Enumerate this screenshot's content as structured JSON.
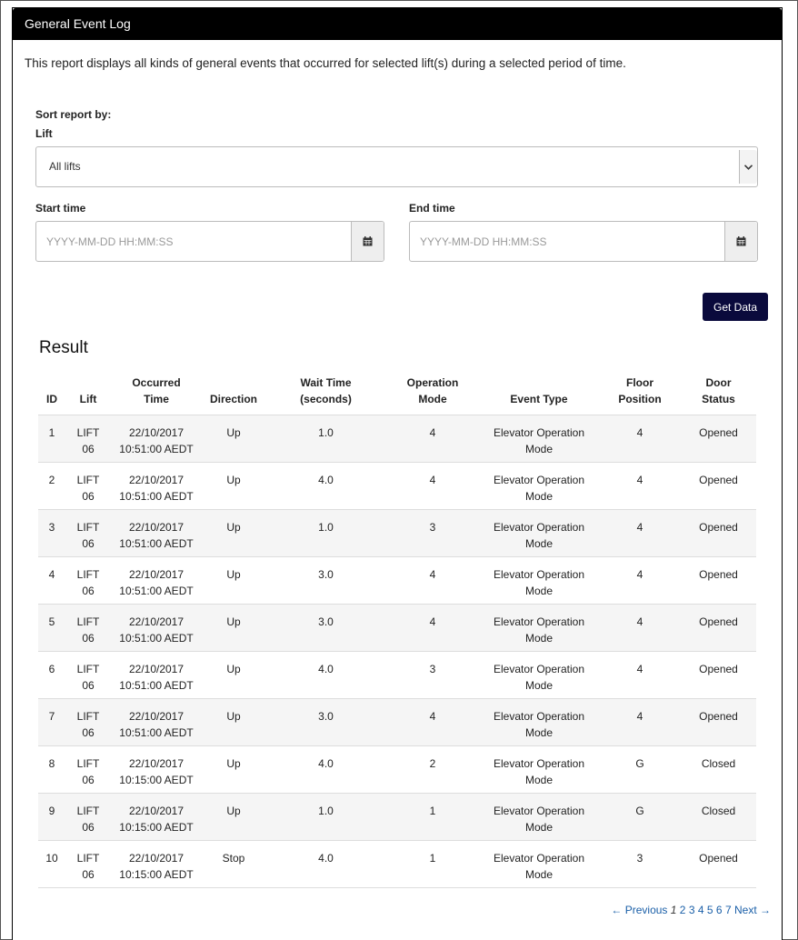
{
  "panel": {
    "title": "General Event Log"
  },
  "intro": "This report displays all kinds of general events that occurred for selected lift(s) during a selected period of time.",
  "form": {
    "sort_label": "Sort report by:",
    "lift_label": "Lift",
    "lift_value": "All lifts",
    "start_label": "Start time",
    "start_placeholder": "YYYY-MM-DD HH:MM:SS",
    "end_label": "End time",
    "end_placeholder": "YYYY-MM-DD HH:MM:SS",
    "get_data_label": "Get Data"
  },
  "result": {
    "title": "Result",
    "columns": [
      [
        "ID"
      ],
      [
        "Lift"
      ],
      [
        "Occurred",
        "Time"
      ],
      [
        "Direction"
      ],
      [
        "Wait Time",
        "(seconds)"
      ],
      [
        "Operation",
        "Mode"
      ],
      [
        "Event Type"
      ],
      [
        "Floor",
        "Position"
      ],
      [
        "Door",
        "Status"
      ]
    ],
    "rows": [
      [
        "1",
        [
          "LIFT",
          "06"
        ],
        [
          "22/10/2017",
          "10:51:00 AEDT"
        ],
        "Up",
        "1.0",
        "4",
        [
          "Elevator Operation",
          "Mode"
        ],
        "4",
        "Opened"
      ],
      [
        "2",
        [
          "LIFT",
          "06"
        ],
        [
          "22/10/2017",
          "10:51:00 AEDT"
        ],
        "Up",
        "4.0",
        "4",
        [
          "Elevator Operation",
          "Mode"
        ],
        "4",
        "Opened"
      ],
      [
        "3",
        [
          "LIFT",
          "06"
        ],
        [
          "22/10/2017",
          "10:51:00 AEDT"
        ],
        "Up",
        "1.0",
        "3",
        [
          "Elevator Operation",
          "Mode"
        ],
        "4",
        "Opened"
      ],
      [
        "4",
        [
          "LIFT",
          "06"
        ],
        [
          "22/10/2017",
          "10:51:00 AEDT"
        ],
        "Up",
        "3.0",
        "4",
        [
          "Elevator Operation",
          "Mode"
        ],
        "4",
        "Opened"
      ],
      [
        "5",
        [
          "LIFT",
          "06"
        ],
        [
          "22/10/2017",
          "10:51:00 AEDT"
        ],
        "Up",
        "3.0",
        "4",
        [
          "Elevator Operation",
          "Mode"
        ],
        "4",
        "Opened"
      ],
      [
        "6",
        [
          "LIFT",
          "06"
        ],
        [
          "22/10/2017",
          "10:51:00 AEDT"
        ],
        "Up",
        "4.0",
        "3",
        [
          "Elevator Operation",
          "Mode"
        ],
        "4",
        "Opened"
      ],
      [
        "7",
        [
          "LIFT",
          "06"
        ],
        [
          "22/10/2017",
          "10:51:00 AEDT"
        ],
        "Up",
        "3.0",
        "4",
        [
          "Elevator Operation",
          "Mode"
        ],
        "4",
        "Opened"
      ],
      [
        "8",
        [
          "LIFT",
          "06"
        ],
        [
          "22/10/2017",
          "10:15:00 AEDT"
        ],
        "Up",
        "4.0",
        "2",
        [
          "Elevator Operation",
          "Mode"
        ],
        "G",
        "Closed"
      ],
      [
        "9",
        [
          "LIFT",
          "06"
        ],
        [
          "22/10/2017",
          "10:15:00 AEDT"
        ],
        "Up",
        "1.0",
        "1",
        [
          "Elevator Operation",
          "Mode"
        ],
        "G",
        "Closed"
      ],
      [
        "10",
        [
          "LIFT",
          "06"
        ],
        [
          "22/10/2017",
          "10:15:00 AEDT"
        ],
        "Stop",
        "4.0",
        "1",
        [
          "Elevator Operation",
          "Mode"
        ],
        "3",
        "Opened"
      ]
    ]
  },
  "pagination": {
    "previous": "← Previous",
    "current": "1",
    "pages": [
      "2",
      "3",
      "4",
      "5",
      "6",
      "7"
    ],
    "next": "Next →"
  },
  "icons": {
    "calendar": "calendar-icon",
    "dropdown": "chevron-down-icon"
  }
}
